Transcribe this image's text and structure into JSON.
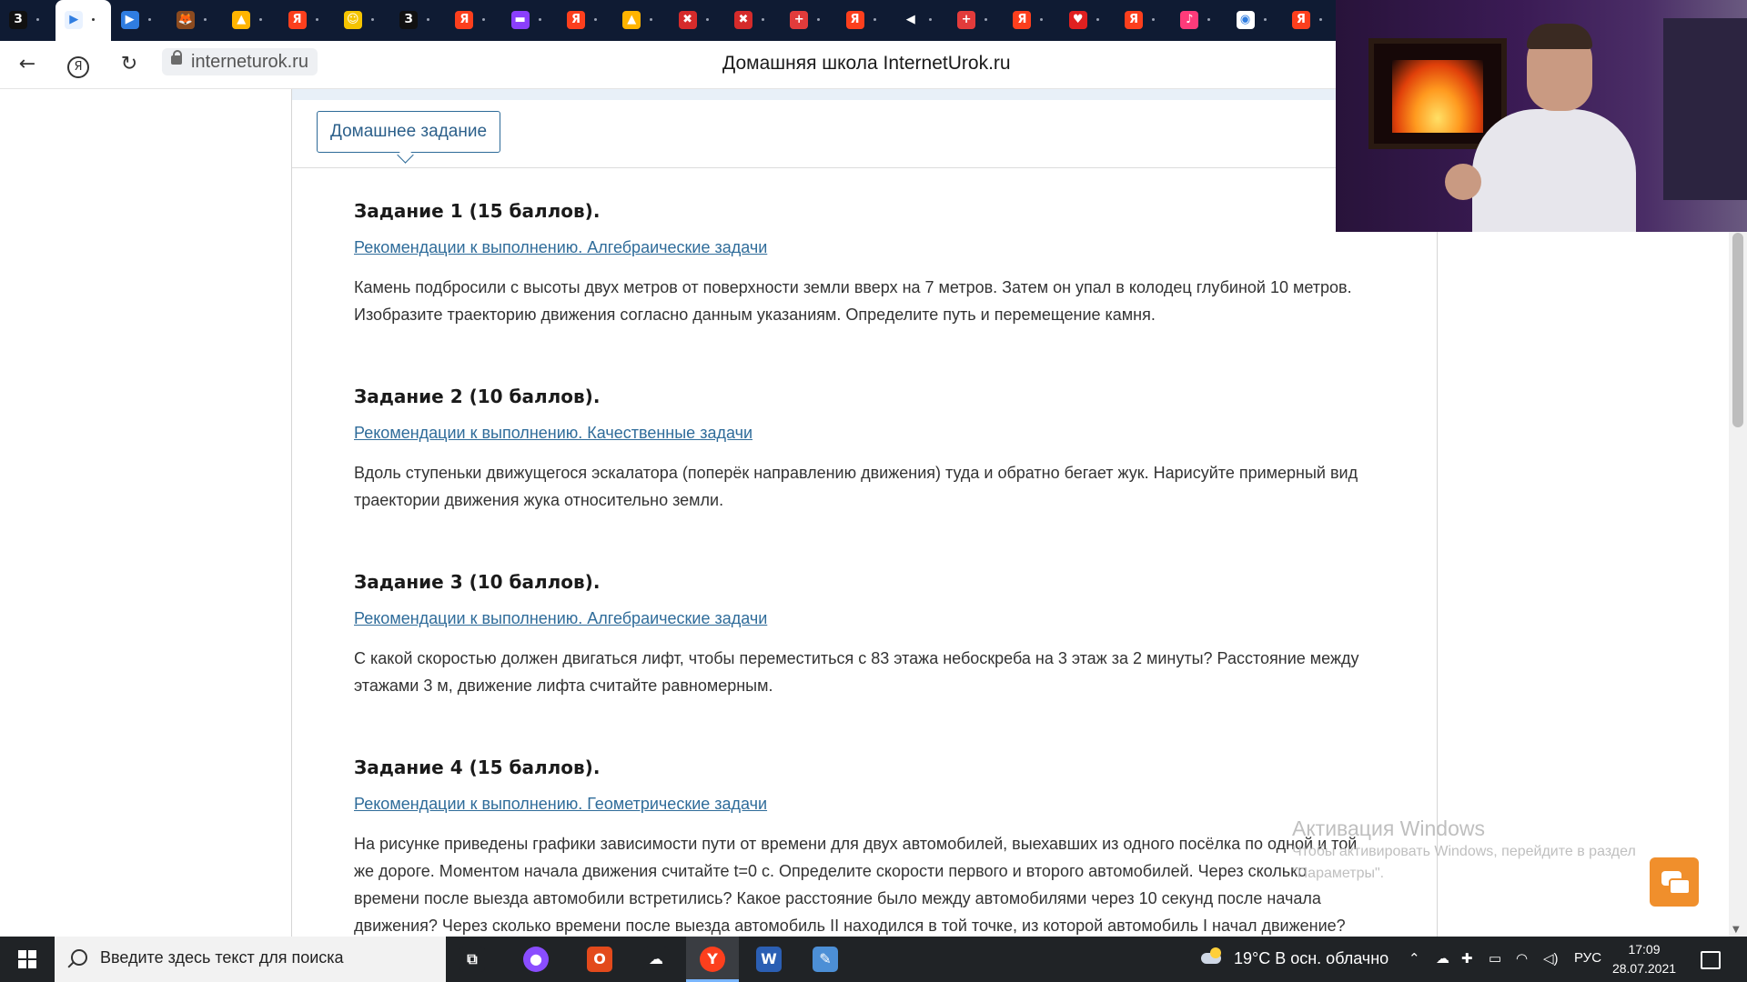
{
  "browser": {
    "tabs": [
      {
        "glyph": "З",
        "color": "#111111",
        "active": false
      },
      {
        "glyph": "▶",
        "color": "#e9f2ff",
        "active": true
      },
      {
        "glyph": "▶",
        "color": "#2f7de1",
        "active": false
      },
      {
        "glyph": "🦊",
        "color": "#8b4a1f",
        "active": false
      },
      {
        "glyph": "▲",
        "color": "#ffb400",
        "active": false
      },
      {
        "glyph": "Я",
        "color": "#fc3f1d",
        "active": false
      },
      {
        "glyph": "☺",
        "color": "#f5c400",
        "active": false
      },
      {
        "glyph": "З",
        "color": "#111111",
        "active": false
      },
      {
        "glyph": "Я",
        "color": "#fc3f1d",
        "active": false
      },
      {
        "glyph": "▬",
        "color": "#8a3ffc",
        "active": false
      },
      {
        "glyph": "Я",
        "color": "#fc3f1d",
        "active": false
      },
      {
        "glyph": "▲",
        "color": "#ffb400",
        "active": false
      },
      {
        "glyph": "✖",
        "color": "#d52b2b",
        "active": false
      },
      {
        "glyph": "✖",
        "color": "#d52b2b",
        "active": false
      },
      {
        "glyph": "+",
        "color": "#e23b3b",
        "active": false
      },
      {
        "glyph": "Я",
        "color": "#fc3f1d",
        "active": false
      },
      {
        "glyph": "◀",
        "color": "#0f1b33",
        "active": false
      },
      {
        "glyph": "+",
        "color": "#e23b3b",
        "active": false
      },
      {
        "glyph": "Я",
        "color": "#fc3f1d",
        "active": false
      },
      {
        "glyph": "♥",
        "color": "#e02020",
        "active": false
      },
      {
        "glyph": "Я",
        "color": "#fc3f1d",
        "active": false
      },
      {
        "glyph": "♪",
        "color": "#ff3b7a",
        "active": false
      },
      {
        "glyph": "◉",
        "color": "#ffffff",
        "active": false
      },
      {
        "glyph": "Я",
        "color": "#fc3f1d",
        "active": false
      }
    ],
    "url": "interneturok.ru",
    "title": "Домашняя школа InternetUrok.ru"
  },
  "page": {
    "homework_tab": "Домашнее задание",
    "tasks": [
      {
        "title": "Задание 1 (15 баллов).",
        "link": "Рекомендации к выполнению. Алгебраические задачи",
        "text": "Камень подбросили с высоты двух метров от поверхности земли вверх на 7 метров. Затем он упал в колодец глубиной 10 метров. Изобразите траекторию движения согласно данным указаниям. Определите путь и перемещение камня."
      },
      {
        "title": "Задание 2 (10 баллов).",
        "link": "Рекомендации к выполнению. Качественные задачи",
        "text": "Вдоль ступеньки движущегося эскалатора (поперёк направлению движения) туда и обратно бегает жук. Нарисуйте примерный вид траектории движения жука относительно земли."
      },
      {
        "title": "Задание 3 (10 баллов).",
        "link": "Рекомендации к выполнению. Алгебраические задачи",
        "text": "С какой скоростью должен двигаться лифт, чтобы переместиться с 83 этажа небоскреба на 3 этаж за 2 минуты? Расстояние между этажами 3 м, движение лифта считайте равномерным."
      },
      {
        "title": "Задание 4 (15 баллов).",
        "link": "Рекомендации к выполнению. Геометрические задачи",
        "text": "На рисунке приведены графики зависимости пути от времени для двух автомобилей, выехавших из одного посёлка по одной и той же дороге. Моментом начала движения считайте t=0 с. Определите скорости первого и второго автомобилей. Через сколько времени после выезда автомобили встретились? Какое расстояние было между автомобилями через 10 секунд после начала движения? Через сколько времени после выезда автомобиль II находился в той точке, из которой автомобиль I начал движение?"
      }
    ],
    "watermark": {
      "title": "Активация Windows",
      "line1": "Чтобы активировать Windows, перейдите в раздел",
      "line2": "\"Параметры\"."
    }
  },
  "taskbar": {
    "search_placeholder": "Введите здесь текст для поиска",
    "weather": "19°C  В осн. облачно",
    "language": "РУС",
    "time": "17:09",
    "date": "28.07.2021",
    "apps": [
      {
        "name": "task-view",
        "glyph": "⧉",
        "color": "#202326"
      },
      {
        "name": "alice",
        "glyph": "●",
        "color": "#8a4dff"
      },
      {
        "name": "office",
        "glyph": "O",
        "color": "#e34a1c"
      },
      {
        "name": "onedrive",
        "glyph": "☁",
        "color": "#202326"
      },
      {
        "name": "yandex-browser",
        "glyph": "Y",
        "color": "#fc3f1d"
      },
      {
        "name": "word",
        "glyph": "W",
        "color": "#2b5fb4"
      },
      {
        "name": "paint",
        "glyph": "✎",
        "color": "#4c8fd6"
      }
    ]
  }
}
